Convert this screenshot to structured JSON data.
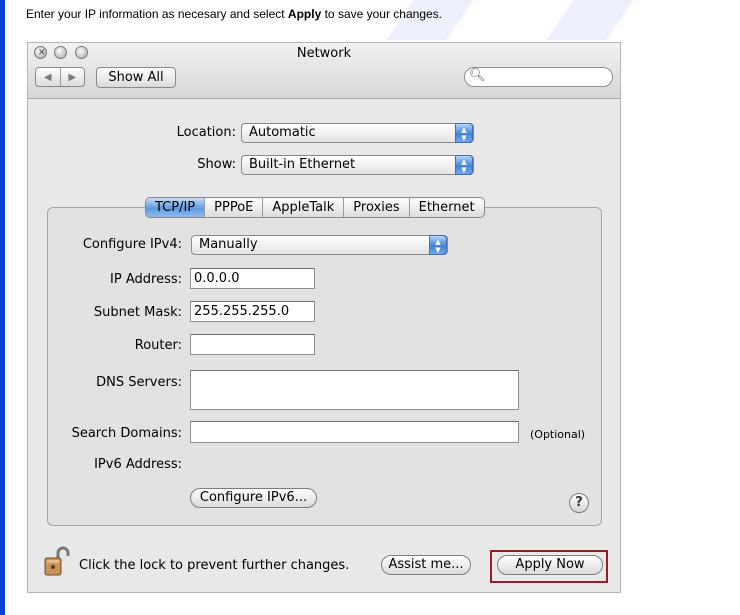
{
  "instruction": {
    "before": "Enter your IP information as necesary and select ",
    "bold": "Apply",
    "after": " to save your changes."
  },
  "window": {
    "title": "Network",
    "back_glyph": "◀",
    "forward_glyph": "▶",
    "show_all_label": "Show All",
    "search_value": "",
    "search_placeholder": ""
  },
  "location": {
    "label": "Location:",
    "value": "Automatic"
  },
  "show": {
    "label": "Show:",
    "value": "Built-in Ethernet"
  },
  "tabs": [
    {
      "label": "TCP/IP",
      "selected": true
    },
    {
      "label": "PPPoE",
      "selected": false
    },
    {
      "label": "AppleTalk",
      "selected": false
    },
    {
      "label": "Proxies",
      "selected": false
    },
    {
      "label": "Ethernet",
      "selected": false
    }
  ],
  "tcpip": {
    "configure_ipv4": {
      "label": "Configure IPv4:",
      "value": "Manually"
    },
    "ip_address": {
      "label": "IP Address:",
      "value": "0.0.0.0"
    },
    "subnet_mask": {
      "label": "Subnet Mask:",
      "value": "255.255.255.0"
    },
    "router": {
      "label": "Router:",
      "value": ""
    },
    "dns_servers": {
      "label": "DNS Servers:",
      "value": ""
    },
    "search_domains": {
      "label": "Search Domains:",
      "value": "",
      "hint": "(Optional)"
    },
    "ipv6_address": {
      "label": "IPv6 Address:"
    },
    "configure_ipv6_label": "Configure IPv6...",
    "help_label": "?"
  },
  "footer": {
    "lock_text": "Click the lock to prevent further changes.",
    "assist_label": "Assist me...",
    "apply_label": "Apply Now"
  },
  "colors": {
    "highlight_border": "#9a1c22",
    "popup_arrow_blue": "#3d84d8",
    "xp_border_blue": "#0a3fd6"
  },
  "icons": {
    "close": "close-icon",
    "minimize": "minimize-icon",
    "zoom": "zoom-icon",
    "search": "magnifier-icon",
    "lock": "padlock-open-icon",
    "help": "help-icon"
  }
}
